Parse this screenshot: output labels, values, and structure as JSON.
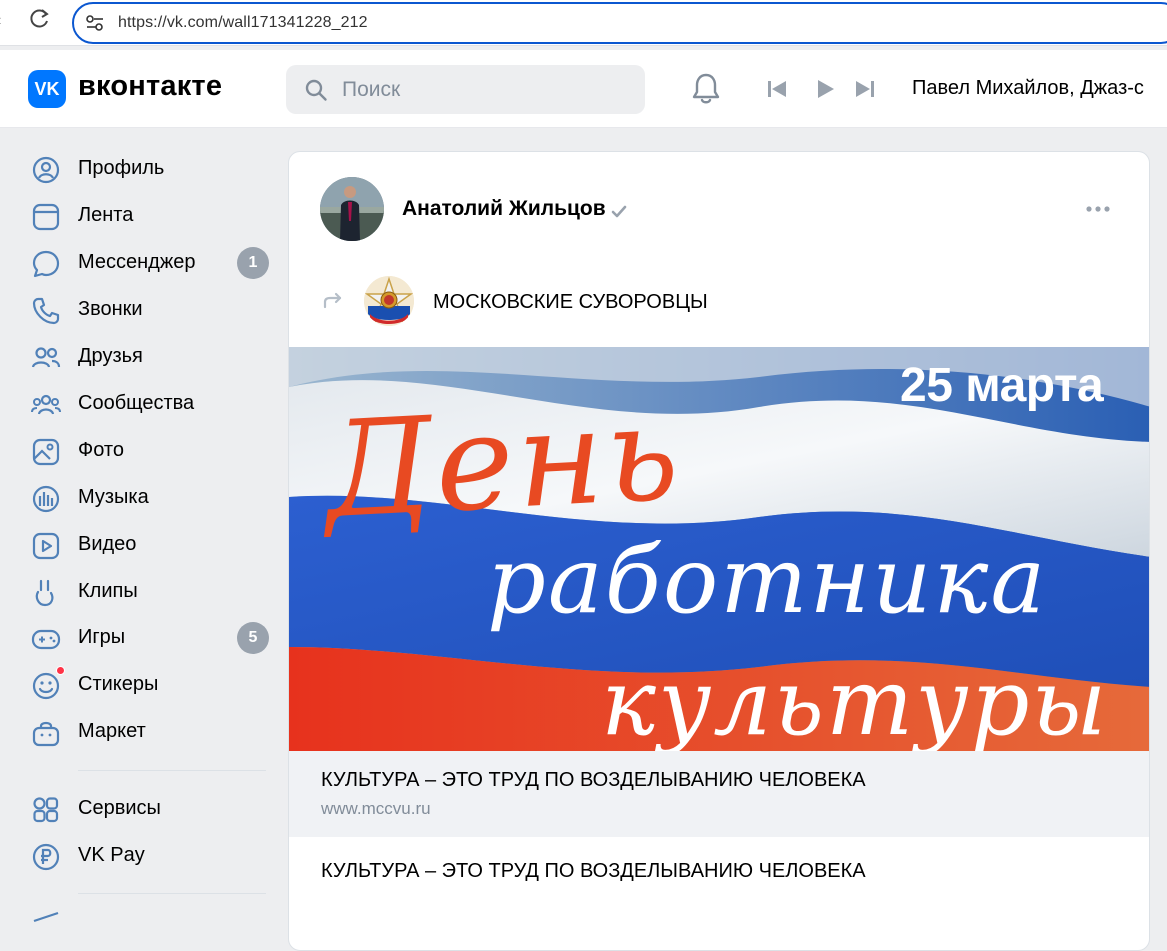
{
  "browser": {
    "url": "https://vk.com/wall171341228_212"
  },
  "header": {
    "logo_text": "VK",
    "wordmark": "вконтакте",
    "search_placeholder": "Поиск",
    "player_track": "Павел Михайлов, Джаз-с"
  },
  "sidebar": {
    "items": [
      {
        "label": "Профиль",
        "icon": "profile-icon"
      },
      {
        "label": "Лента",
        "icon": "feed-icon"
      },
      {
        "label": "Мессенджер",
        "icon": "messenger-icon",
        "badge": "1"
      },
      {
        "label": "Звонки",
        "icon": "phone-icon"
      },
      {
        "label": "Друзья",
        "icon": "friends-icon"
      },
      {
        "label": "Сообщества",
        "icon": "communities-icon"
      },
      {
        "label": "Фото",
        "icon": "photo-icon"
      },
      {
        "label": "Музыка",
        "icon": "music-icon"
      },
      {
        "label": "Видео",
        "icon": "video-icon"
      },
      {
        "label": "Клипы",
        "icon": "clips-icon"
      },
      {
        "label": "Игры",
        "icon": "games-icon",
        "badge": "5"
      },
      {
        "label": "Стикеры",
        "icon": "stickers-icon"
      },
      {
        "label": "Маркет",
        "icon": "market-icon"
      }
    ],
    "items2": [
      {
        "label": "Сервисы",
        "icon": "services-icon"
      },
      {
        "label": "VK Pay",
        "icon": "vkpay-icon"
      }
    ]
  },
  "post": {
    "author": "Анатолий Жильцов",
    "group_name": "МОСКОВСКИЕ СУВОРОВЦЫ",
    "image": {
      "date": "25 марта",
      "line1": "День",
      "line2": "работника",
      "line3": "культуры"
    },
    "link_title": "КУЛЬТУРА – ЭТО ТРУД ПО ВОЗДЕЛЫВАНИЮ ЧЕЛОВЕКА",
    "link_url": "www.mccvu.ru",
    "text": "КУЛЬТУРА – ЭТО ТРУД ПО ВОЗДЕЛЫВАНИЮ ЧЕЛОВЕКА"
  },
  "colors": {
    "accent": "#0077ff",
    "icon": "#5181b8",
    "badge": "#99a2ad"
  }
}
